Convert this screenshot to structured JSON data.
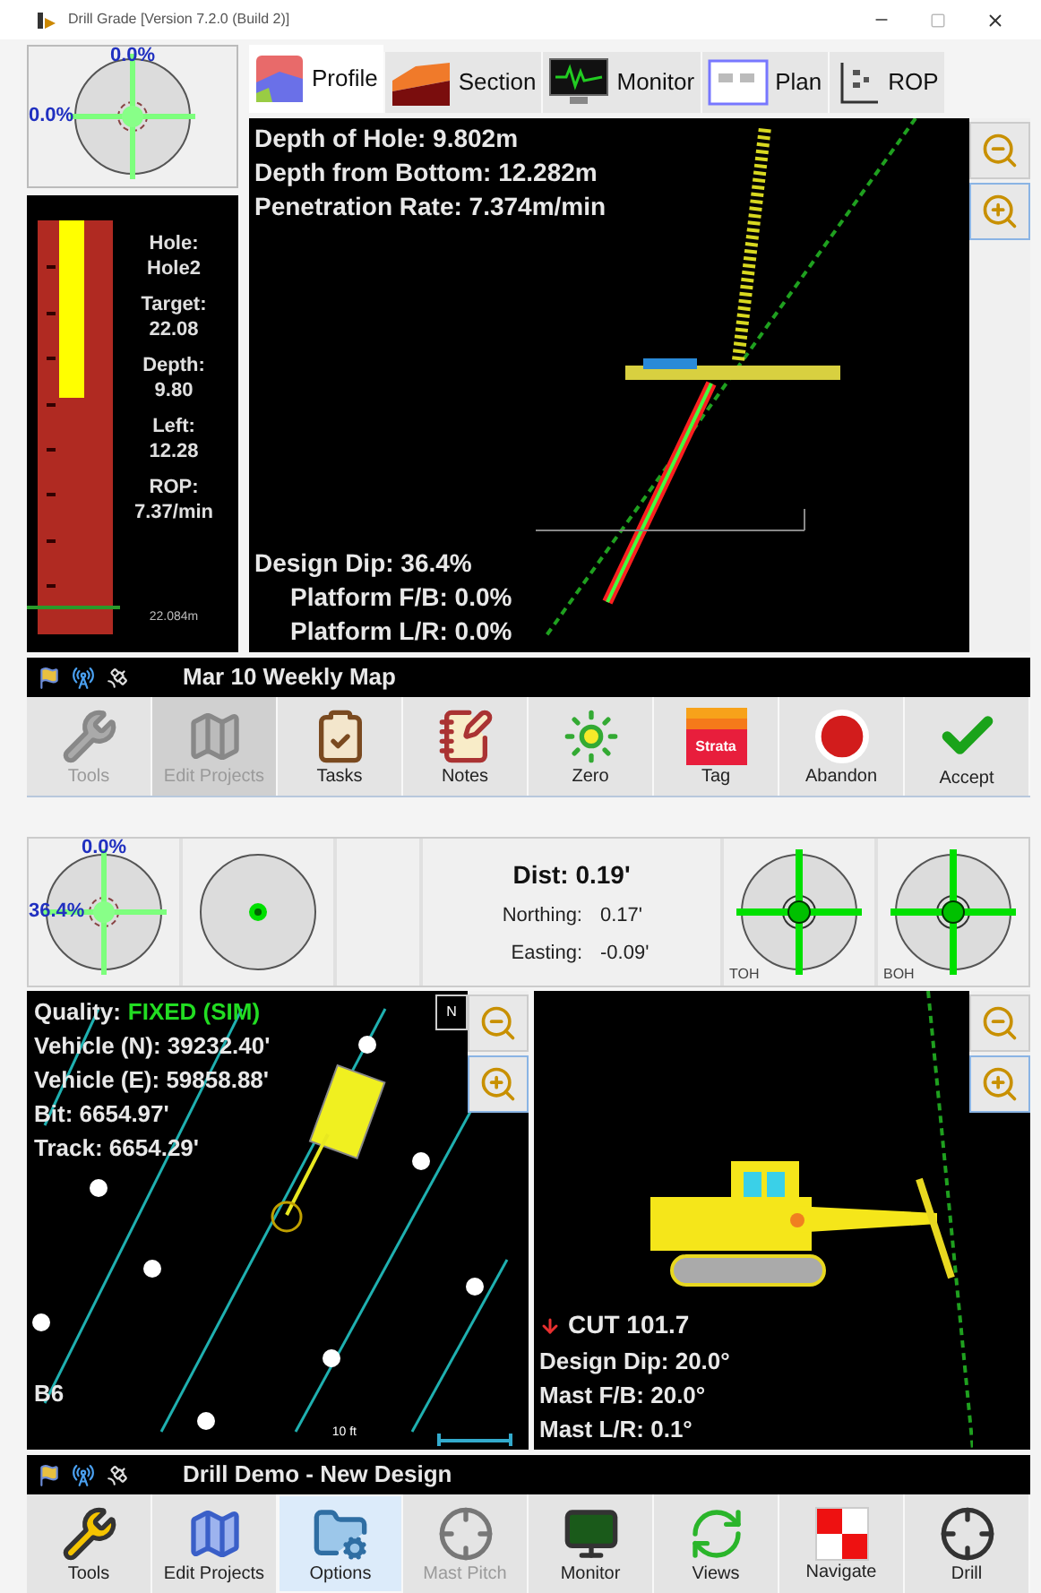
{
  "window": {
    "title": "Drill Grade [Version 7.2.0 (Build 2)]"
  },
  "drill_screen": {
    "tilt_dial": {
      "kind": "tilt",
      "top_reading": "0.0%",
      "left_reading": "0.0%"
    },
    "tabs": [
      {
        "label": "Profile",
        "kind": "profile",
        "selected": true
      },
      {
        "label": "Section",
        "kind": "section",
        "selected": false
      },
      {
        "label": "Monitor",
        "kind": "monitor",
        "selected": false
      },
      {
        "label": "Plan",
        "kind": "plan",
        "selected": false
      },
      {
        "label": "ROP",
        "kind": "rop",
        "selected": false
      }
    ],
    "depth_gauge": {
      "level": 0.43,
      "readouts": [
        {
          "label": "Hole:",
          "value": "Hole2"
        },
        {
          "label": "Target:",
          "value": "22.08"
        },
        {
          "label": "Depth:",
          "value": "9.80"
        },
        {
          "label": "Left:",
          "value": "12.28"
        },
        {
          "label": "ROP:",
          "value": "7.37/min"
        }
      ],
      "bottom_reading": "22.084m"
    },
    "profile": {
      "readouts": [
        "Depth of Hole: 9.802m",
        "Depth from Bottom: 12.282m",
        "Penetration Rate: 7.374m/min"
      ],
      "design_readouts": [
        "Design Dip: 36.4%",
        "Platform F/B: 0.0%",
        "Platform L/R: 0.0%"
      ]
    },
    "status_bar": {
      "title": "Mar 10 Weekly Map"
    },
    "toolbar": [
      {
        "label": "Tools",
        "kind": "tools",
        "disabled": true,
        "selected": false
      },
      {
        "label": "Edit Projects",
        "kind": "edit",
        "disabled": true,
        "selected": false
      },
      {
        "label": "Tasks",
        "kind": "tasks",
        "disabled": false,
        "selected": false
      },
      {
        "label": "Notes",
        "kind": "notes",
        "disabled": false,
        "selected": false
      },
      {
        "label": "Zero",
        "kind": "zero",
        "disabled": false,
        "selected": false
      },
      {
        "label": "Tag",
        "kind": "tag",
        "icon_text": "Strata",
        "disabled": false,
        "selected": false
      },
      {
        "label": "Abandon",
        "kind": "abandon",
        "disabled": false,
        "selected": false
      },
      {
        "label": "Accept",
        "kind": "accept",
        "disabled": false,
        "selected": false
      }
    ]
  },
  "navigate_screen": {
    "dials": [
      {
        "kind": "tilt",
        "top_reading": "0.0%",
        "left_reading": "36.4%"
      },
      {
        "kind": "target"
      },
      {
        "kind": "empty"
      }
    ],
    "distance": {
      "dist": "Dist: 0.19'",
      "rows": [
        {
          "label": "Northing:",
          "value": "0.17'"
        },
        {
          "label": "Easting:",
          "value": "-0.09'"
        }
      ]
    },
    "hole_dials": [
      {
        "kind": "crosshair",
        "label": "TOH"
      },
      {
        "kind": "crosshair",
        "label": "BOH"
      }
    ],
    "map": {
      "quality_label": "Quality:",
      "quality_value": "FIXED (SIM)",
      "readouts": [
        "Vehicle (N): 39232.40'",
        "Vehicle (E): 59858.88'",
        "Bit: 6654.97'",
        "Track: 6654.29'"
      ],
      "hole_label": "B6",
      "north_label": "N",
      "scale_label": "10 ft"
    },
    "rig_view": {
      "cut": "CUT 101.7",
      "readouts": [
        "Design Dip: 20.0°",
        "Mast F/B: 20.0°",
        "Mast L/R: 0.1°"
      ]
    },
    "status_bar": {
      "title": "Drill Demo - New Design"
    },
    "toolbar": [
      {
        "label": "Tools",
        "kind": "tools",
        "disabled": false,
        "selected": false
      },
      {
        "label": "Edit Projects",
        "kind": "edit",
        "disabled": false,
        "selected": false
      },
      {
        "label": "Options",
        "kind": "options",
        "disabled": false,
        "selected": true
      },
      {
        "label": "Mast Pitch",
        "kind": "mast",
        "disabled": true,
        "selected": false
      },
      {
        "label": "Monitor",
        "kind": "monitor",
        "disabled": false,
        "selected": false
      },
      {
        "label": "Views",
        "kind": "views",
        "disabled": false,
        "selected": false
      },
      {
        "label": "Navigate",
        "kind": "navigate",
        "disabled": false,
        "selected": false
      },
      {
        "label": "Drill",
        "kind": "drill",
        "disabled": false,
        "selected": false
      }
    ]
  }
}
